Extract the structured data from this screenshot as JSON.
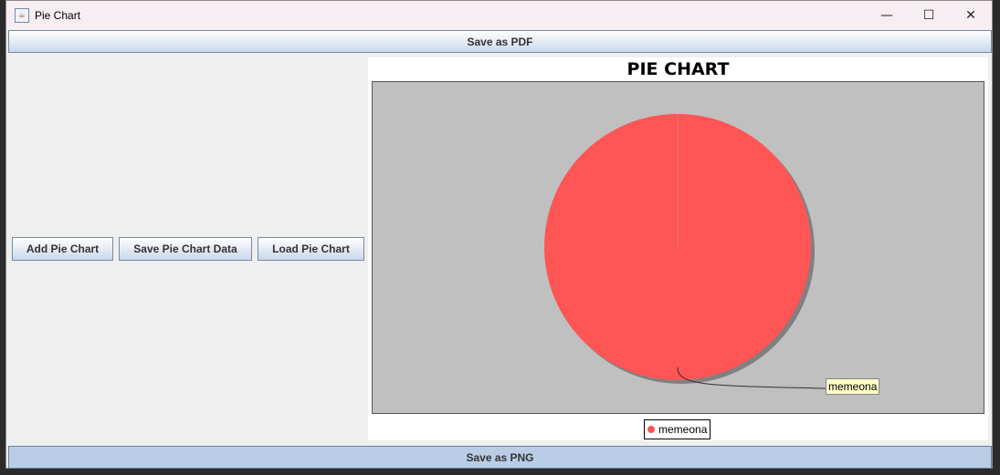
{
  "window": {
    "title": "Pie Chart",
    "minimize_glyph": "—",
    "maximize_glyph": "☐",
    "close_glyph": "✕"
  },
  "toolbar": {
    "save_pdf_label": "Save as PDF",
    "save_png_label": "Save as PNG"
  },
  "controls": {
    "add_label": "Add Pie Chart",
    "save_data_label": "Save Pie Chart Data",
    "load_label": "Load Pie Chart"
  },
  "colors": {
    "slice": "#ff5555",
    "plot_background": "#c0c0c0"
  },
  "chart_data": {
    "type": "pie",
    "title": "PIE CHART",
    "slices": [
      {
        "label": "memeona",
        "value": 100,
        "color": "#ff5555"
      }
    ],
    "legend": "bottom",
    "slice_label": "memeona"
  }
}
